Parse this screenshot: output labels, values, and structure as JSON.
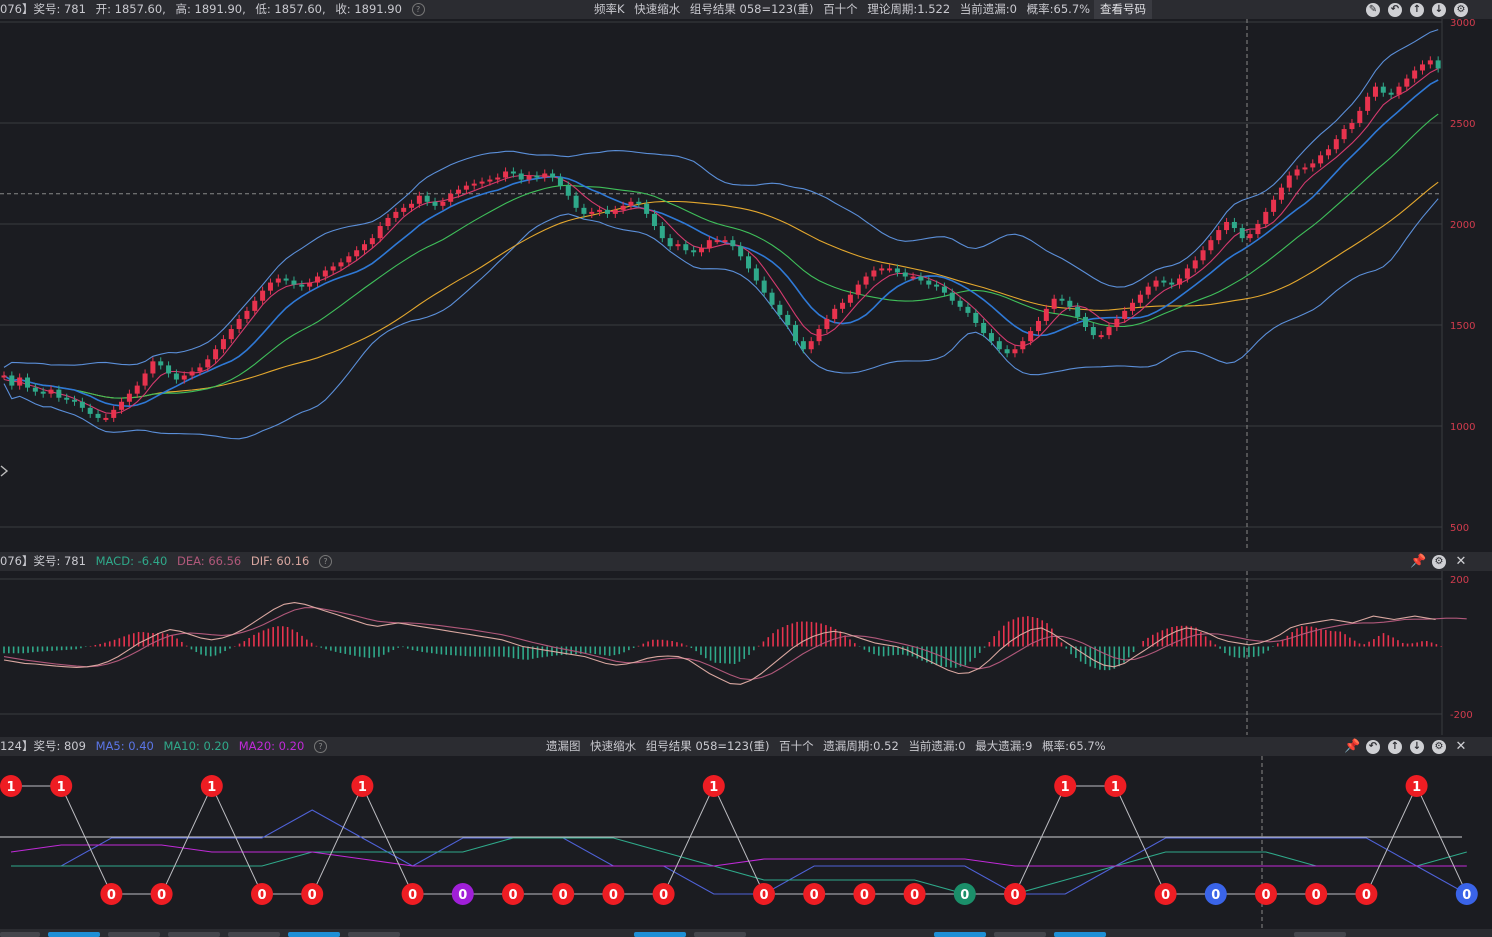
{
  "kline": {
    "header": {
      "id": "076】奖号: 781",
      "open": "开: 1857.60,",
      "high": "高: 1891.90,",
      "low": "低: 1857.60,",
      "close": "收: 1891.90",
      "center": [
        "频率K",
        "快速缩水",
        "组号结果 058=123(重)",
        "百十个",
        "理论周期:1.522",
        "当前遗漏:0",
        "概率:65.7%"
      ],
      "button": "查看号码"
    },
    "y_ticks": [
      "3000",
      "2500",
      "2000",
      "1500",
      "1000",
      "500"
    ]
  },
  "macd": {
    "header": {
      "id": "076】奖号: 781",
      "macd": "MACD: -6.40",
      "dea": "DEA: 66.56",
      "dif": "DIF: 60.16"
    },
    "y_ticks": [
      "200",
      "-200"
    ]
  },
  "omission": {
    "header": {
      "id": "124】奖号: 809",
      "ma5": "MA5: 0.40",
      "ma10": "MA10: 0.20",
      "ma20": "MA20: 0.20",
      "center": [
        "遗漏图",
        "快速缩水",
        "组号结果 058=123(重)",
        "百十个",
        "遗漏周期:0.52",
        "当前遗漏:0",
        "最大遗漏:9",
        "概率:65.7%"
      ]
    }
  },
  "colors": {
    "up": "#e8334e",
    "down": "#2fa98a",
    "ma5": "#d43a6e",
    "ma10": "#2f79d6",
    "ma20": "#3fbf5a",
    "ma40": "#e3a72e",
    "boll": "#5b8fd9",
    "dif": "#d9a7a0",
    "dea": "#b0587a",
    "node_red": "#ee1d23",
    "node_purple": "#a01fd8",
    "node_green": "#1b8f6a",
    "node_blue": "#3a64e8"
  },
  "chart_data": [
    {
      "type": "candlestick",
      "title": "",
      "ylim": [
        500,
        3000
      ],
      "y_ticks": [
        3000,
        2500,
        2000,
        1500,
        1000,
        500
      ],
      "grid": true,
      "close": [
        1250,
        1200,
        1240,
        1190,
        1170,
        1160,
        1180,
        1140,
        1130,
        1120,
        1090,
        1060,
        1040,
        1040,
        1080,
        1120,
        1160,
        1200,
        1260,
        1320,
        1300,
        1260,
        1230,
        1250,
        1270,
        1290,
        1330,
        1380,
        1430,
        1480,
        1530,
        1570,
        1620,
        1670,
        1710,
        1730,
        1720,
        1700,
        1690,
        1710,
        1740,
        1770,
        1790,
        1810,
        1840,
        1870,
        1900,
        1930,
        1990,
        2030,
        2060,
        2080,
        2100,
        2140,
        2110,
        2090,
        2110,
        2150,
        2170,
        2190,
        2200,
        2210,
        2220,
        2230,
        2260,
        2250,
        2220,
        2240,
        2230,
        2250,
        2230,
        2190,
        2140,
        2080,
        2050,
        2060,
        2070,
        2050,
        2070,
        2090,
        2110,
        2100,
        2050,
        1990,
        1930,
        1890,
        1900,
        1870,
        1860,
        1880,
        1920,
        1920,
        1920,
        1890,
        1840,
        1780,
        1720,
        1660,
        1600,
        1550,
        1500,
        1420,
        1380,
        1420,
        1480,
        1530,
        1580,
        1610,
        1650,
        1700,
        1740,
        1770,
        1780,
        1780,
        1760,
        1740,
        1740,
        1720,
        1700,
        1690,
        1660,
        1620,
        1590,
        1560,
        1510,
        1460,
        1420,
        1380,
        1360,
        1380,
        1420,
        1470,
        1520,
        1580,
        1630,
        1620,
        1590,
        1540,
        1490,
        1450,
        1450,
        1490,
        1530,
        1570,
        1610,
        1650,
        1690,
        1720,
        1710,
        1700,
        1730,
        1780,
        1820,
        1870,
        1920,
        1970,
        2010,
        1980,
        1930,
        1950,
        2000,
        2060,
        2120,
        2180,
        2240,
        2270,
        2280,
        2300,
        2340,
        2370,
        2420,
        2470,
        2500,
        2560,
        2630,
        2680,
        2650,
        2640,
        2680,
        2720,
        2760,
        2790,
        2810,
        2770
      ],
      "ma": {
        "MA5": [
          1230,
          1222,
          1218,
          1205,
          1195,
          1180,
          1170,
          1160,
          1150,
          1136,
          1118,
          1100,
          1080,
          1065,
          1062,
          1070,
          1090,
          1120,
          1160,
          1210,
          1250,
          1270,
          1270,
          1265,
          1262,
          1266,
          1280,
          1310,
          1350,
          1400,
          1450,
          1500,
          1550,
          1600,
          1640,
          1670,
          1690,
          1700,
          1705,
          1708,
          1716,
          1730,
          1750,
          1770,
          1795,
          1820,
          1850,
          1880,
          1915,
          1955,
          1995,
          2035,
          2065,
          2090,
          2105,
          2110,
          2115,
          2125,
          2135,
          2150,
          2165,
          2180,
          2195,
          2210,
          2225,
          2235,
          2240,
          2240,
          2238,
          2238,
          2234,
          2225,
          2205,
          2175,
          2140,
          2110,
          2085,
          2065,
          2060,
          2065,
          2075,
          2080,
          2075,
          2060,
          2030,
          1990,
          1950,
          1915,
          1890,
          1880,
          1880,
          1890,
          1900,
          1900,
          1890,
          1865,
          1830,
          1780,
          1725,
          1670,
          1610,
          1550,
          1495,
          1460,
          1445,
          1455,
          1480,
          1520,
          1565,
          1610,
          1650,
          1690,
          1720,
          1745,
          1755,
          1755,
          1750,
          1742,
          1730,
          1715,
          1695,
          1670,
          1640,
          1610,
          1575,
          1535,
          1495,
          1455,
          1420,
          1400,
          1395,
          1410,
          1440,
          1480,
          1525,
          1565,
          1590,
          1595,
          1585,
          1560,
          1530,
          1510,
          1505,
          1515,
          1540,
          1570,
          1605,
          1640,
          1670,
          1690,
          1705,
          1725,
          1750,
          1780,
          1815,
          1855,
          1900,
          1940,
          1965,
          1975,
          1975,
          1985,
          2010,
          2050,
          2100,
          2155,
          2205,
          2240,
          2270,
          2300,
          2330,
          2365,
          2400,
          2440,
          2485,
          2540,
          2590,
          2620,
          2640,
          2660,
          2690,
          2720,
          2750,
          2770
        ]
      },
      "macd": {
        "ylim": [
          -200,
          200
        ],
        "dif": [
          -40,
          -45,
          -50,
          -52,
          -55,
          -58,
          -60,
          -62,
          -60,
          -55,
          -45,
          -30,
          -10,
          10,
          25,
          40,
          50,
          45,
          35,
          25,
          20,
          25,
          35,
          50,
          70,
          90,
          110,
          125,
          130,
          125,
          115,
          105,
          95,
          85,
          75,
          65,
          60,
          65,
          70,
          65,
          60,
          55,
          50,
          45,
          40,
          35,
          30,
          25,
          20,
          10,
          0,
          -5,
          -10,
          -15,
          -20,
          -25,
          -30,
          -40,
          -50,
          -55,
          -52,
          -45,
          -35,
          -30,
          -28,
          -30,
          -40,
          -60,
          -80,
          -95,
          -110,
          -112,
          -100,
          -80,
          -55,
          -30,
          -5,
          15,
          30,
          40,
          45,
          40,
          30,
          20,
          10,
          5,
          0,
          -10,
          -25,
          -40,
          -55,
          -70,
          -80,
          -78,
          -65,
          -40,
          -10,
          15,
          35,
          50,
          55,
          40,
          20,
          0,
          -20,
          -40,
          -55,
          -60,
          -50,
          -30,
          -10,
          10,
          30,
          45,
          55,
          50,
          40,
          25,
          15,
          10,
          5,
          10,
          20,
          35,
          55,
          65,
          70,
          75,
          80,
          75,
          70,
          80,
          90,
          85,
          80,
          85,
          90,
          85,
          80
        ],
        "dea": [
          -30,
          -35,
          -40,
          -44,
          -48,
          -52,
          -55,
          -58,
          -60,
          -58,
          -52,
          -42,
          -28,
          -12,
          5,
          20,
          32,
          38,
          40,
          38,
          35,
          33,
          35,
          42,
          52,
          65,
          80,
          95,
          108,
          115,
          115,
          110,
          104,
          97,
          90,
          82,
          75,
          72,
          70,
          70,
          68,
          65,
          62,
          58,
          54,
          50,
          45,
          40,
          35,
          28,
          20,
          12,
          5,
          -2,
          -8,
          -14,
          -20,
          -28,
          -36,
          -44,
          -48,
          -48,
          -45,
          -40,
          -36,
          -34,
          -36,
          -44,
          -56,
          -70,
          -84,
          -95,
          -98,
          -92,
          -80,
          -62,
          -42,
          -22,
          -5,
          10,
          22,
          30,
          32,
          30,
          25,
          18,
          12,
          5,
          -3,
          -13,
          -25,
          -38,
          -52,
          -62,
          -66,
          -60,
          -46,
          -28,
          -10,
          8,
          22,
          30,
          30,
          22,
          10,
          -5,
          -20,
          -33,
          -40,
          -38,
          -28,
          -15,
          0,
          14,
          26,
          35,
          38,
          37,
          32,
          26,
          20,
          16,
          14,
          17,
          25,
          35,
          44,
          52,
          58,
          64,
          68,
          70,
          70,
          72,
          76,
          80,
          81,
          81,
          82,
          84,
          84,
          82
        ]
      }
    },
    {
      "type": "omission_line",
      "title": "遗漏图",
      "values": [
        1,
        1,
        0,
        0,
        1,
        0,
        0,
        1,
        0,
        0,
        0,
        0,
        0,
        0,
        1,
        0,
        0,
        0,
        0,
        0,
        0,
        1,
        1,
        0,
        0,
        0,
        0,
        0,
        1,
        0
      ],
      "node_colors": [
        "red",
        "red",
        "red",
        "red",
        "red",
        "red",
        "red",
        "red",
        "red",
        "purple",
        "red",
        "red",
        "red",
        "red",
        "red",
        "red",
        "red",
        "red",
        "red",
        "green",
        "red",
        "red",
        "red",
        "red",
        "blue",
        "red",
        "red",
        "red",
        "red",
        "blue"
      ],
      "ma": {
        "MA5": [
          0.2,
          0.2,
          0.4,
          0.4,
          0.4,
          0.4,
          0.6,
          0.4,
          0.2,
          0.4,
          0.4,
          0.4,
          0.2,
          0.2,
          0.0,
          0.0,
          0.2,
          0.2,
          0.2,
          0.2,
          0.0,
          0.0,
          0.2,
          0.4,
          0.4,
          0.4,
          0.4,
          0.4,
          0.2,
          0.0
        ],
        "MA10": [
          0.2,
          0.2,
          0.2,
          0.2,
          0.2,
          0.2,
          0.3,
          0.3,
          0.3,
          0.3,
          0.4,
          0.4,
          0.4,
          0.3,
          0.2,
          0.1,
          0.1,
          0.1,
          0.1,
          0.0,
          0.0,
          0.1,
          0.2,
          0.3,
          0.3,
          0.3,
          0.2,
          0.2,
          0.2,
          0.3
        ],
        "MA20": [
          0.3,
          0.35,
          0.35,
          0.35,
          0.3,
          0.3,
          0.3,
          0.25,
          0.2,
          0.2,
          0.2,
          0.2,
          0.2,
          0.2,
          0.2,
          0.25,
          0.25,
          0.25,
          0.25,
          0.25,
          0.2,
          0.2,
          0.2,
          0.2,
          0.2,
          0.2,
          0.2,
          0.2,
          0.2,
          0.2
        ]
      }
    }
  ]
}
